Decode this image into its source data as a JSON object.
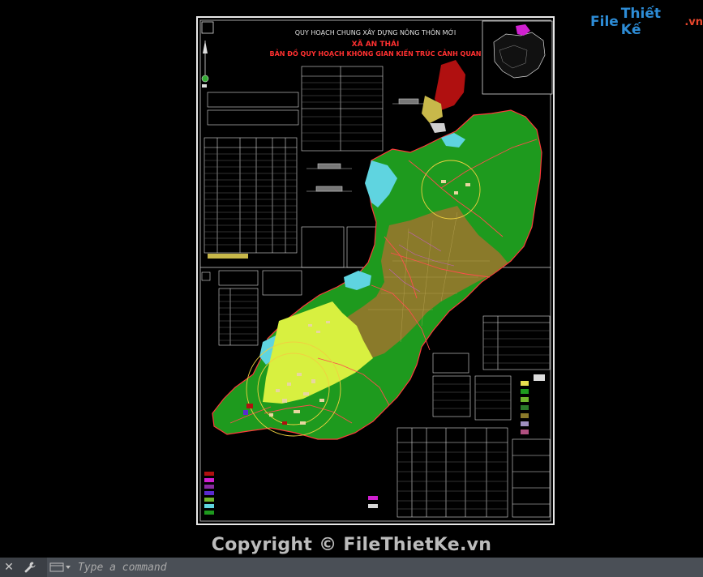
{
  "drawing": {
    "title_line1": "QUY HOẠCH CHUNG XÂY DỰNG NÔNG THÔN MỚI",
    "title_line2": "XÃ AN THÁI",
    "title_line3": "BẢN ĐỒ QUY HOẠCH KHÔNG GIAN KIẾN TRÚC CẢNH QUAN"
  },
  "watermark": {
    "logo_file": "File",
    "logo_thiet": "Thiết Kế",
    "logo_domain": ".vn",
    "copyright": "Copyright © FileThietKe.vn"
  },
  "command_line": {
    "placeholder": "Type a command"
  },
  "icons": {
    "close": "close-icon",
    "customize": "wrench-icon",
    "history": "command-history-icon"
  },
  "colors": {
    "background": "#000000",
    "forest_green": "#1e9a1e",
    "residential_olive": "#8a7a2a",
    "yellow_green_zone": "#d8f040",
    "water_cyan": "#5fd4e0",
    "admin_red": "#b01010",
    "title_red": "#ff3030"
  }
}
